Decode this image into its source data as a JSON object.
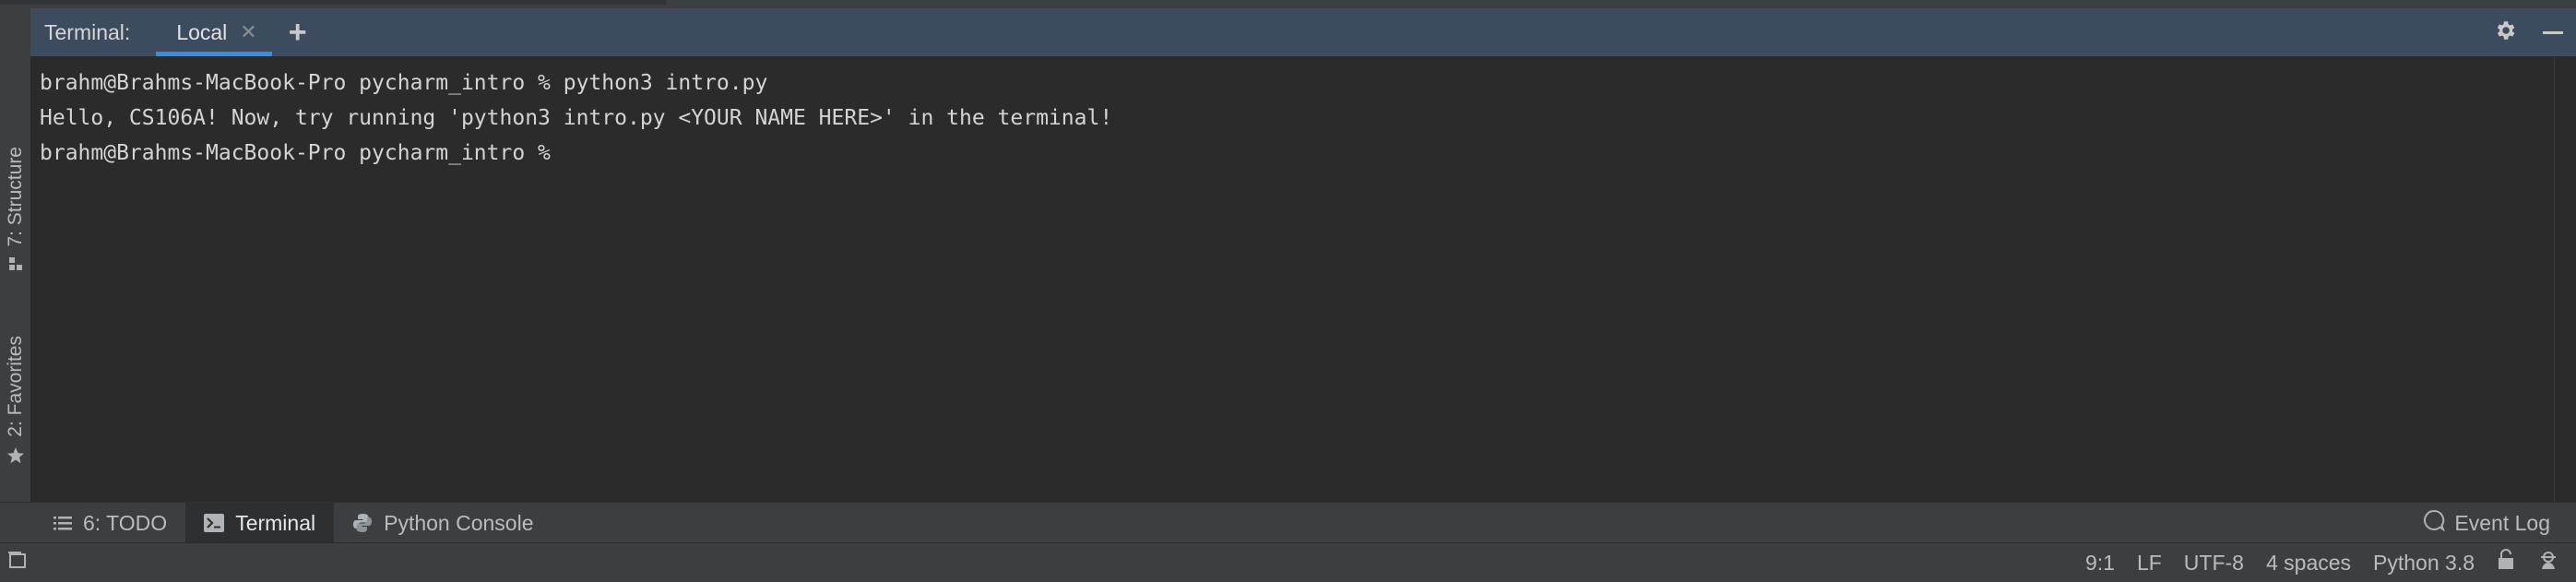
{
  "header": {
    "title": "Terminal:",
    "tabs": [
      {
        "label": "Local"
      }
    ]
  },
  "terminal": {
    "lines": [
      "brahm@Brahms-MacBook-Pro pycharm_intro % python3 intro.py",
      "Hello, CS106A! Now, try running 'python3 intro.py <YOUR NAME HERE>' in the terminal!",
      "brahm@Brahms-MacBook-Pro pycharm_intro % "
    ]
  },
  "left_strip": {
    "structure_label": "7: Structure",
    "favorites_label": "2: Favorites"
  },
  "bottom_tabs": {
    "todo": "6: TODO",
    "terminal": "Terminal",
    "python_console": "Python Console",
    "event_log": "Event Log"
  },
  "status": {
    "position": "9:1",
    "line_separator": "LF",
    "encoding": "UTF-8",
    "indent": "4 spaces",
    "interpreter": "Python 3.8"
  },
  "icons": {
    "add": "plus-icon",
    "settings": "gear-icon",
    "minimize": "minimize-icon",
    "close": "close-icon"
  },
  "colors": {
    "header_bg": "#3c4b5e",
    "tab_underline": "#4a88c7",
    "terminal_bg": "#2b2b2b",
    "panel_bg": "#3c3f41"
  }
}
